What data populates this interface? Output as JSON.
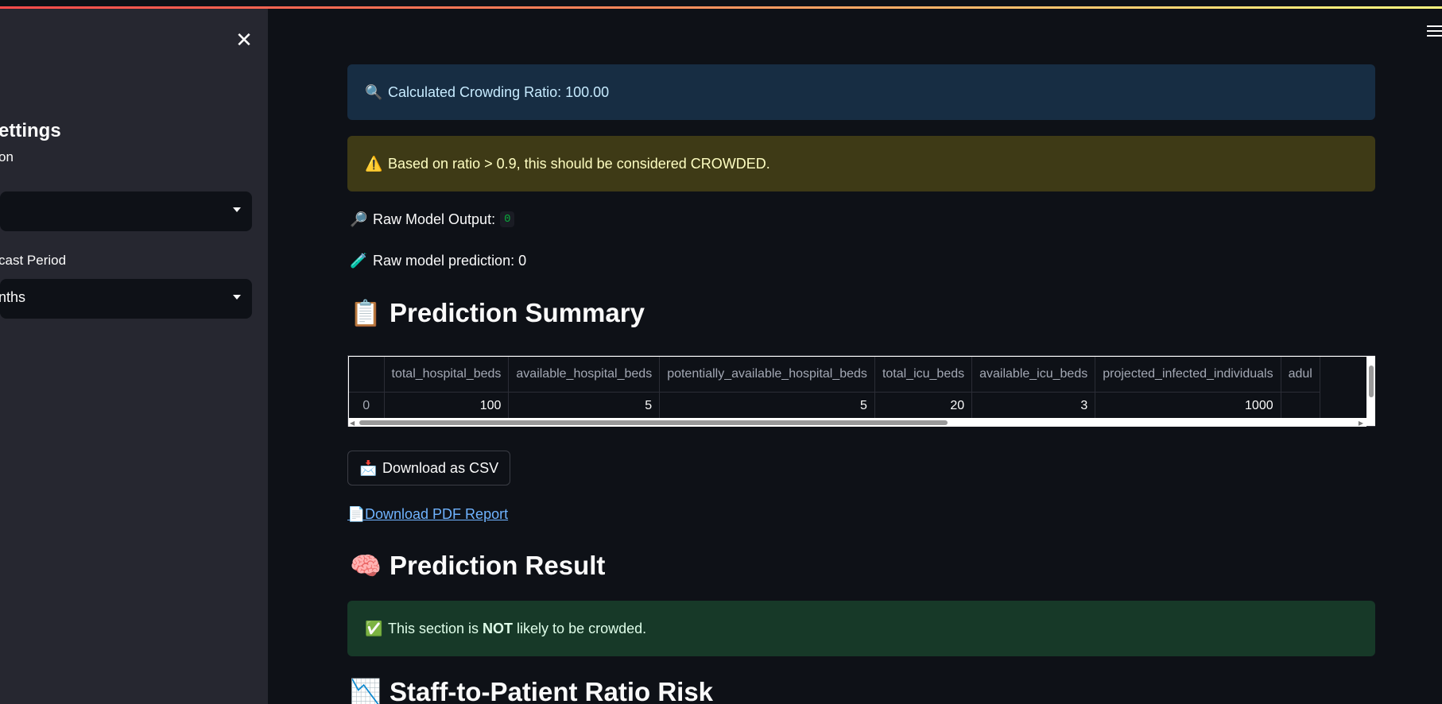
{
  "sidebar": {
    "heading": "ettings",
    "field1_label": "on",
    "field1_value": "",
    "field2_label": "cast Period",
    "field2_value": "nths",
    "close_glyph": "✕"
  },
  "alerts": {
    "info_icon": "🔍",
    "info_text": "Calculated Crowding Ratio: 100.00",
    "warn_icon": "⚠️",
    "warn_text": "Based on ratio > 0.9, this should be considered CROWDED.",
    "ok_icon": "✅",
    "ok_prefix": "This section is ",
    "ok_bold": "NOT",
    "ok_suffix": " likely to be crowded."
  },
  "raw_output": {
    "icon": "🔎",
    "label": "Raw Model Output:",
    "value": "0"
  },
  "raw_prediction": {
    "icon": "🧪",
    "text": "Raw model prediction: 0"
  },
  "prediction_summary": {
    "icon": "📋",
    "title": "Prediction Summary"
  },
  "table": {
    "headers": [
      "",
      "total_hospital_beds",
      "available_hospital_beds",
      "potentially_available_hospital_beds",
      "total_icu_beds",
      "available_icu_beds",
      "projected_infected_individuals",
      "adul"
    ],
    "rows": [
      [
        "0",
        "100",
        "5",
        "5",
        "20",
        "3",
        "1000",
        ""
      ]
    ]
  },
  "download_csv": {
    "icon": "📩",
    "label": "Download as CSV"
  },
  "download_pdf": {
    "icon": "📄",
    "label": " Download PDF Report"
  },
  "prediction_result": {
    "icon": "🧠",
    "title": "Prediction Result"
  },
  "staff_ratio": {
    "icon": "📉",
    "title": "Staff-to-Patient Ratio Risk"
  }
}
